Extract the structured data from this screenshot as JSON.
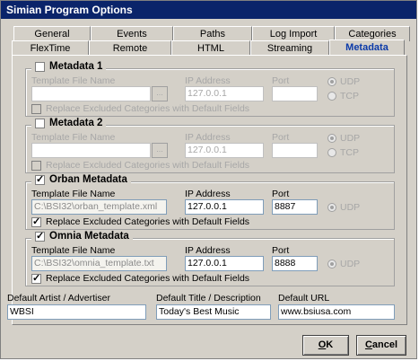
{
  "window": {
    "title": "Simian Program Options"
  },
  "tabs_row1": [
    "General",
    "Events",
    "Paths",
    "Log Import",
    "Categories"
  ],
  "tabs_row2": [
    "FlexTime",
    "Remote",
    "HTML",
    "Streaming",
    "Metadata"
  ],
  "labels": {
    "template_file_name": "Template File Name",
    "ip_address": "IP Address",
    "port": "Port",
    "udp": "UDP",
    "tcp": "TCP",
    "replace_excluded": "Replace Excluded Categories with Default Fields",
    "browse": "..."
  },
  "groups": {
    "metadata1": {
      "title": "Metadata 1",
      "checked": false,
      "template": "",
      "ip": "127.0.0.1",
      "port": "",
      "replace": false
    },
    "metadata2": {
      "title": "Metadata 2",
      "checked": false,
      "template": "",
      "ip": "127.0.0.1",
      "port": "",
      "replace": false
    },
    "orban": {
      "title": "Orban Metadata",
      "checked": true,
      "template": "C:\\BSI32\\orban_template.xml",
      "ip": "127.0.0.1",
      "port": "8887",
      "replace": true
    },
    "omnia": {
      "title": "Omnia Metadata",
      "checked": true,
      "template": "C:\\BSI32\\omnia_template.txt",
      "ip": "127.0.0.1",
      "port": "8888",
      "replace": true
    }
  },
  "defaults": {
    "artist_label": "Default Artist / Advertiser",
    "artist_value": "WBSI",
    "title_label": "Default Title / Description",
    "title_value": "Today's Best Music",
    "url_label": "Default URL",
    "url_value": "www.bsiusa.com"
  },
  "buttons": {
    "ok_underline": "O",
    "ok_rest": "K",
    "cancel_underline": "C",
    "cancel_rest": "ancel"
  }
}
